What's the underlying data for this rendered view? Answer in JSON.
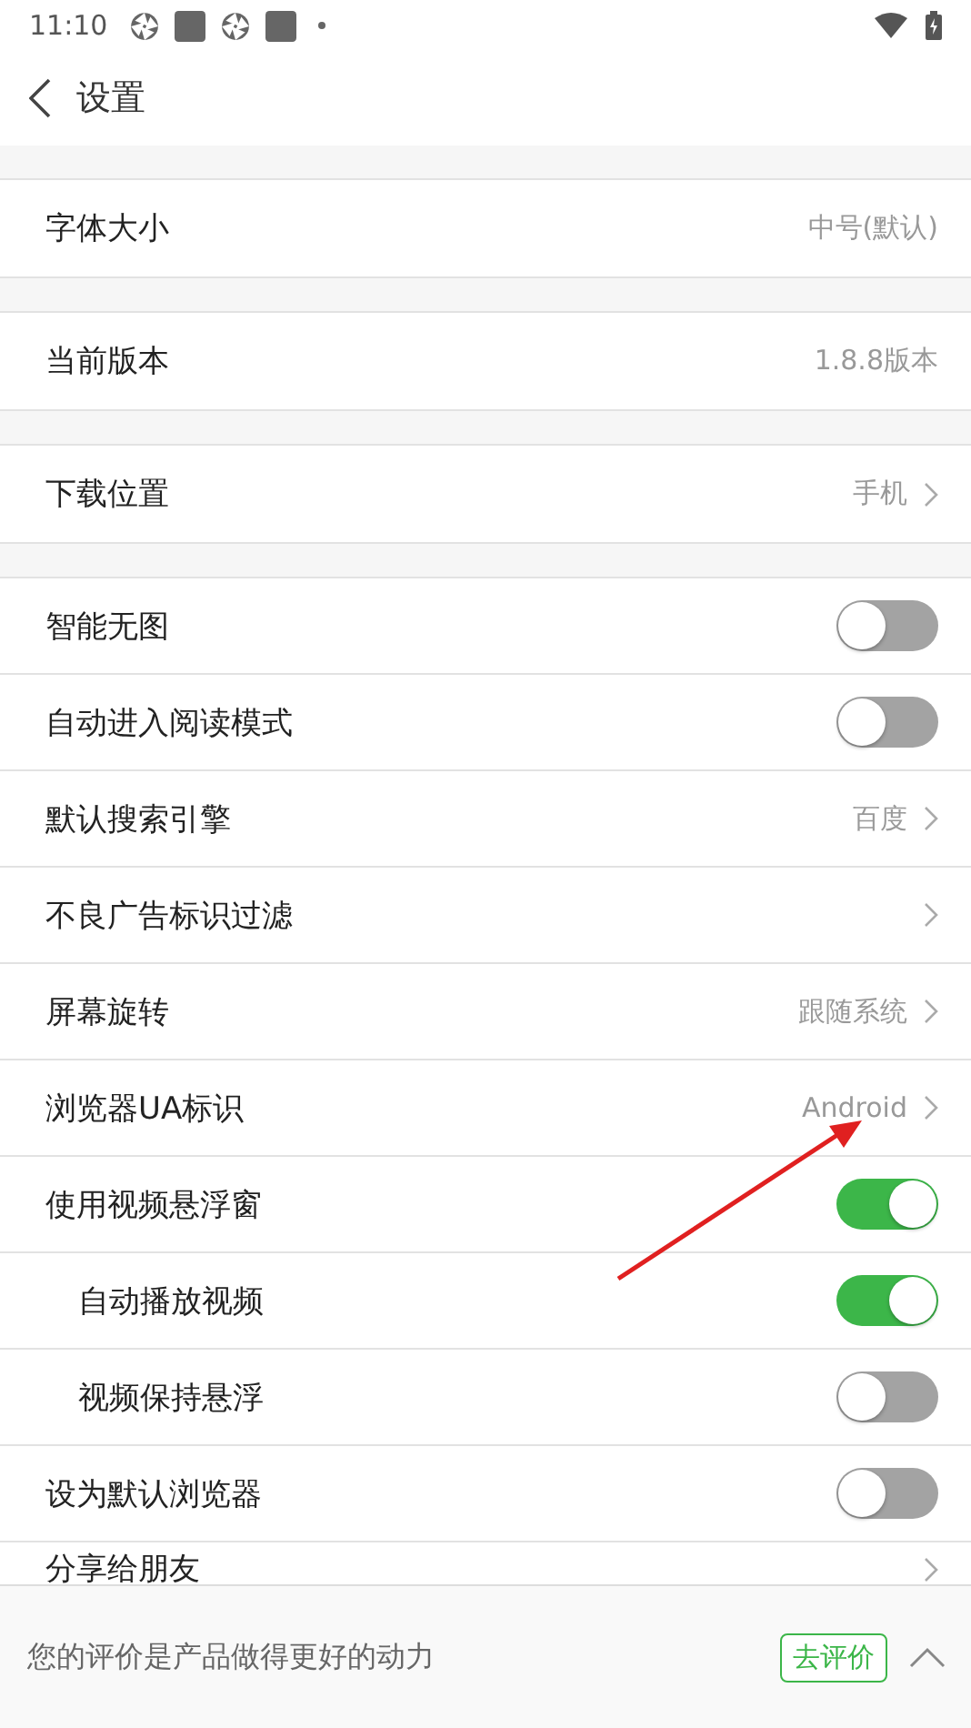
{
  "status_bar": {
    "time": "11:10"
  },
  "header": {
    "title": "设置"
  },
  "sections": [
    {
      "items": [
        {
          "kind": "value",
          "label": "字体大小",
          "value": "中号(默认)"
        }
      ]
    },
    {
      "items": [
        {
          "kind": "value",
          "label": "当前版本",
          "value": "1.8.8版本"
        }
      ]
    },
    {
      "items": [
        {
          "kind": "link",
          "label": "下载位置",
          "value": "手机"
        }
      ]
    },
    {
      "items": [
        {
          "kind": "toggle",
          "label": "智能无图",
          "on": false
        },
        {
          "kind": "toggle",
          "label": "自动进入阅读模式",
          "on": false
        },
        {
          "kind": "link",
          "label": "默认搜索引擎",
          "value": "百度"
        },
        {
          "kind": "link",
          "label": "不良广告标识过滤"
        },
        {
          "kind": "link",
          "label": "屏幕旋转",
          "value": "跟随系统"
        },
        {
          "kind": "link",
          "label": "浏览器UA标识",
          "value": "Android"
        },
        {
          "kind": "toggle",
          "label": "使用视频悬浮窗",
          "on": true,
          "children": [
            {
              "kind": "toggle",
              "label": "自动播放视频",
              "on": true
            },
            {
              "kind": "toggle",
              "label": "视频保持悬浮",
              "on": false
            }
          ]
        },
        {
          "kind": "toggle",
          "label": "设为默认浏览器",
          "on": false
        },
        {
          "kind": "link",
          "label": "分享给朋友"
        }
      ]
    }
  ],
  "rating_bar": {
    "text": "您的评价是产品做得更好的动力",
    "button": "去评价"
  }
}
